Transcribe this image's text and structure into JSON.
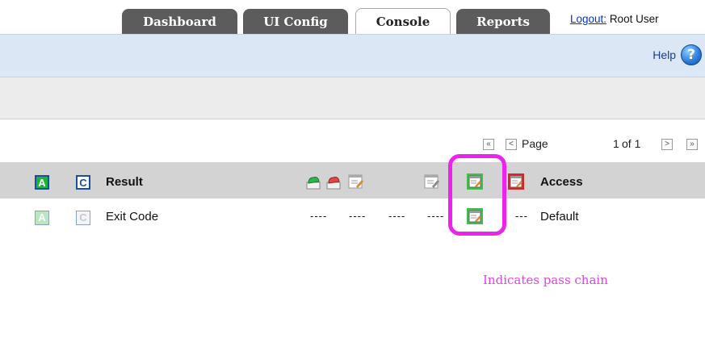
{
  "tabs": [
    {
      "label": "Dashboard",
      "active": false
    },
    {
      "label": "UI Config",
      "active": false
    },
    {
      "label": "Console",
      "active": true
    },
    {
      "label": "Reports",
      "active": false
    }
  ],
  "user": {
    "logout_label": "Logout:",
    "name": "Root User"
  },
  "help": {
    "label": "Help",
    "icon": "help-icon"
  },
  "pager": {
    "first": "«",
    "prev": "<",
    "page_label": "Page",
    "current": "1",
    "of_label": "of 1",
    "next": ">",
    "last": "»"
  },
  "table": {
    "header": {
      "col_a": "A",
      "col_c": "C",
      "result": "Result",
      "access": "Access"
    },
    "rows": [
      {
        "col_a": "A",
        "col_c": "C",
        "result": "Exit Code",
        "access": "Default",
        "dashes": [
          "----",
          "----",
          "----",
          "----",
          "---"
        ]
      }
    ]
  },
  "annotation": {
    "text": "Indicates pass chain",
    "color": "#dd44dd"
  }
}
